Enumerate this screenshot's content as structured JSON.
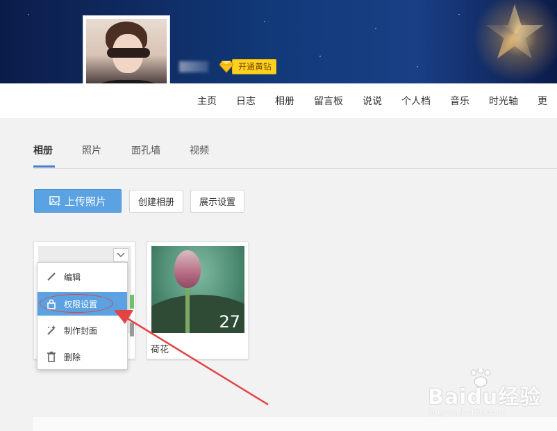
{
  "header": {
    "vip_label": "开通黄钻",
    "nav_items": [
      "主页",
      "日志",
      "相册",
      "留言板",
      "说说",
      "个人档",
      "音乐",
      "时光轴",
      "更"
    ]
  },
  "album_tabs": [
    "相册",
    "照片",
    "面孔墙",
    "视频"
  ],
  "toolbar": {
    "upload_label": "上传照片",
    "create_label": "创建相册",
    "display_label": "展示设置"
  },
  "albums": [
    {
      "name": "",
      "count": ""
    },
    {
      "name": "荷花",
      "count": "27"
    }
  ],
  "context_menu": {
    "items": [
      "编辑",
      "权限设置",
      "制作封面",
      "删除"
    ],
    "highlighted": "权限设置"
  },
  "watermark": {
    "main": "Baidu经验",
    "sub": "jingyan.baidu.com"
  },
  "colors": {
    "accent": "#5aa2e2",
    "annotation": "#e24444",
    "vip": "#ffd21f"
  }
}
